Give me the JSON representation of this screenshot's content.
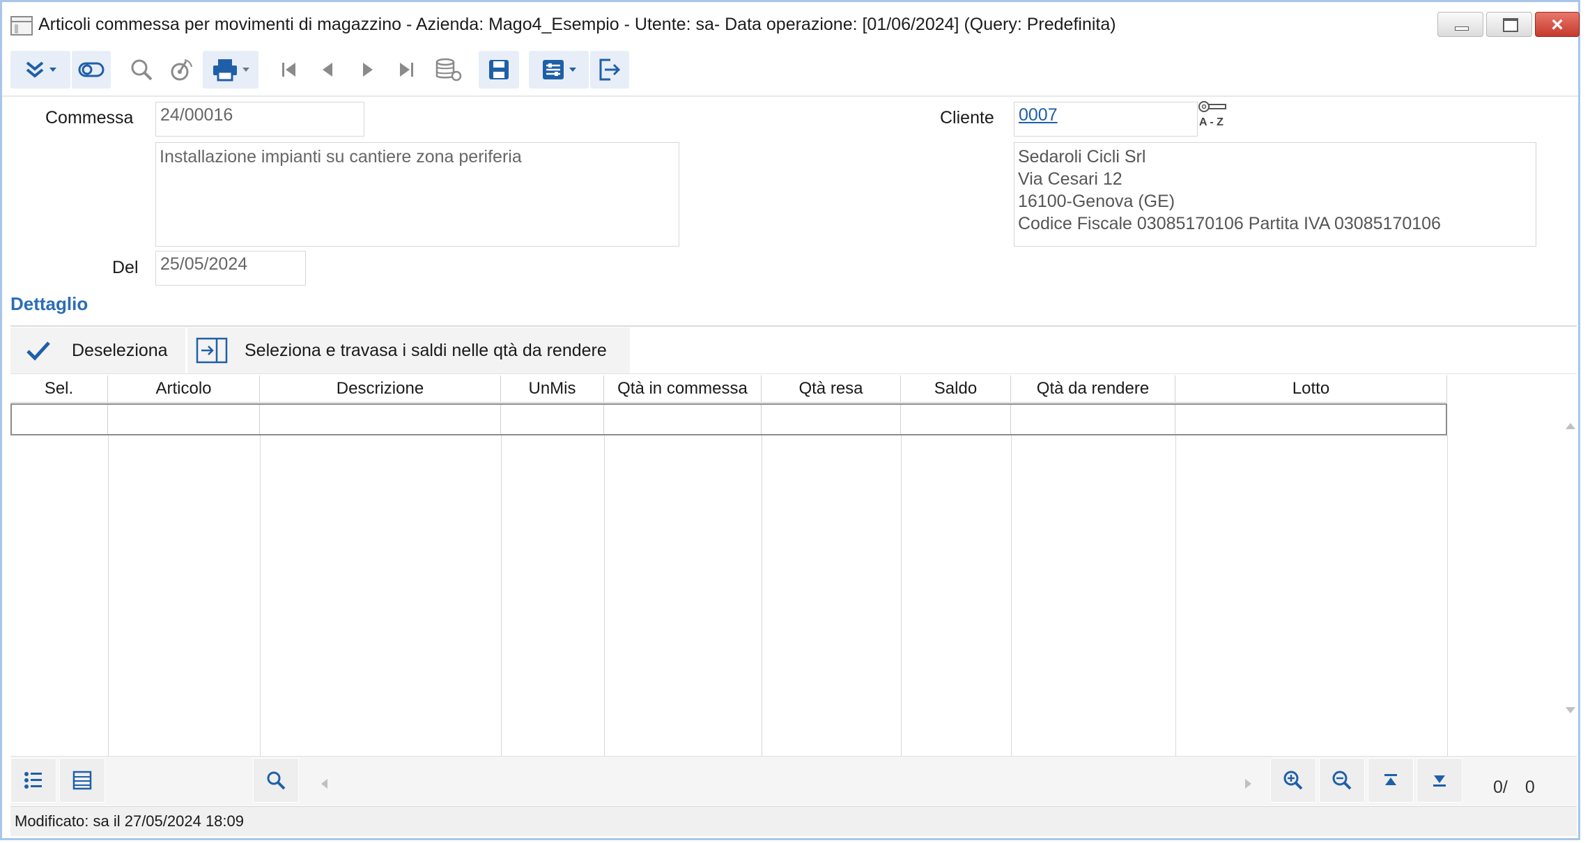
{
  "window": {
    "title": "Articoli commessa per movimenti di magazzino - Azienda: Mago4_Esempio - Utente: sa- Data operazione: [01/06/2024] (Query: Predefinita)",
    "controls": {
      "minimize": "minimize-icon",
      "maximize": "maximize-icon",
      "close": "×"
    }
  },
  "toolbar": {
    "icons": [
      "expand-chevrons-icon",
      "toggle-icon",
      "search-icon",
      "radar-search-icon",
      "print-icon",
      "first-record-icon",
      "previous-record-icon",
      "next-record-icon",
      "last-record-icon",
      "database-refresh-icon",
      "save-icon",
      "options-icon",
      "exit-icon"
    ],
    "accent": "#1f5fa8"
  },
  "form": {
    "commessa_label": "Commessa",
    "commessa_value": "24/00016",
    "commessa_description": "Installazione impianti su cantiere zona periferia",
    "del_label": "Del",
    "del_value": "25/05/2024",
    "cliente_label": "Cliente",
    "cliente_value": "0007",
    "cliente_lookup_icon": "key-az-lookup-icon",
    "cliente_lookup_text": "A - Z",
    "cliente_address": {
      "line1": "Sedaroli Cicli Srl",
      "line2": "Via Cesari 12",
      "line3": "16100-Genova (GE)",
      "line4": "Codice Fiscale 03085170106 Partita IVA 03085170106"
    }
  },
  "detail": {
    "section_title": "Dettaglio",
    "actions": {
      "deselect_label": "Deseleziona",
      "select_transfer_label": "Seleziona e travasa i saldi nelle qtà da rendere"
    },
    "columns": [
      "Sel.",
      "Articolo",
      "Descrizione",
      "UnMis",
      "Qtà in commessa",
      "Qtà resa",
      "Saldo",
      "Qtà da rendere",
      "Lotto"
    ],
    "rows": []
  },
  "grid_footer": {
    "icons": [
      "list-details-icon",
      "table-view-icon",
      "grid-search-icon",
      "zoom-in-icon",
      "zoom-out-icon",
      "go-top-icon",
      "go-bottom-icon"
    ],
    "counter_current": "0/",
    "counter_total": "0"
  },
  "status": {
    "text": "Modificato: sa il 27/05/2024 18:09"
  }
}
